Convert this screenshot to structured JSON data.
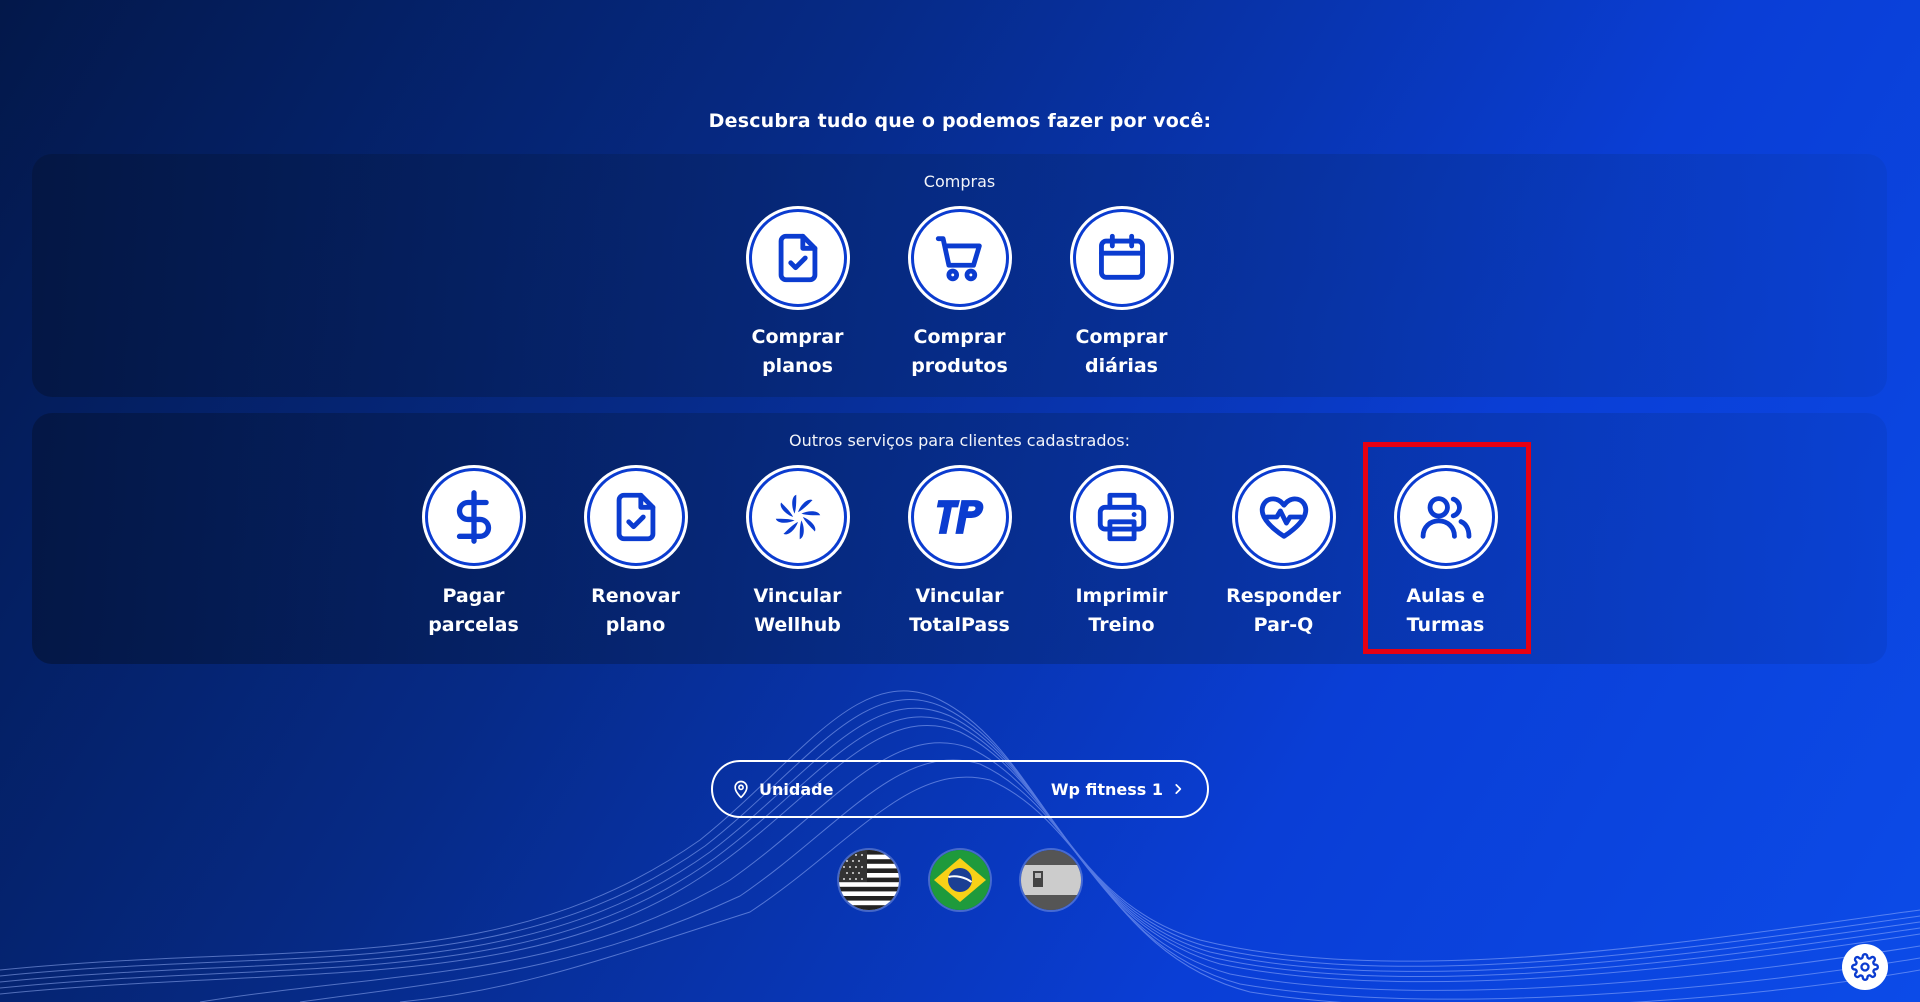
{
  "headline": "Descubra tudo que o podemos fazer por você:",
  "sections": {
    "compras": {
      "title": "Compras",
      "items": [
        {
          "label": "Comprar planos",
          "icon": "document-check-icon"
        },
        {
          "label": "Comprar produtos",
          "icon": "shopping-cart-icon"
        },
        {
          "label": "Comprar diárias",
          "icon": "calendar-icon"
        }
      ]
    },
    "outros": {
      "title": "Outros serviços para clientes cadastrados:",
      "items": [
        {
          "label": "Pagar parcelas",
          "icon": "dollar-icon"
        },
        {
          "label": "Renovar plano",
          "icon": "document-check-icon"
        },
        {
          "label": "Vincular Wellhub",
          "icon": "wellhub-logo-icon"
        },
        {
          "label": "Vincular TotalPass",
          "icon": "totalpass-logo-icon"
        },
        {
          "label": "Imprimir Treino",
          "icon": "printer-icon"
        },
        {
          "label": "Responder Par-Q",
          "icon": "heart-pulse-icon"
        },
        {
          "label": "Aulas e Turmas",
          "icon": "users-icon",
          "highlighted": true
        }
      ]
    }
  },
  "unit_selector": {
    "label": "Unidade",
    "value": "Wp fitness 1",
    "icon": "location-pin-icon"
  },
  "languages": [
    {
      "name": "english",
      "icon": "us-flag-icon"
    },
    {
      "name": "portuguese",
      "icon": "brazil-flag-icon"
    },
    {
      "name": "spanish",
      "icon": "spain-flag-icon"
    }
  ],
  "settings_icon": "gear-icon",
  "colors": {
    "accent": "#0b3cd0",
    "highlight": "#e60012",
    "background_dark": "#03184a",
    "background_light": "#0c4be8"
  }
}
